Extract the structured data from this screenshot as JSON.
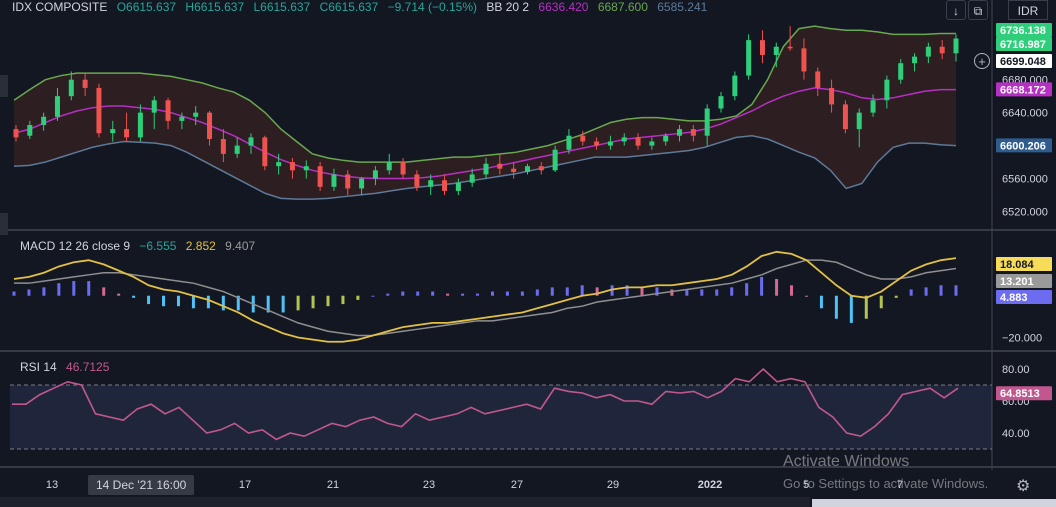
{
  "header": {
    "symbol": "IDX COMPOSITE",
    "o": "O6615.637",
    "h": "H6615.637",
    "l": "L6615.637",
    "c": "C6615.637",
    "chg": "−9.714 (−0.15%)",
    "bb_label": "BB 20 2",
    "bb_mid": "6636.420",
    "bb_up": "6687.600",
    "bb_low": "6585.241",
    "currency": "IDR"
  },
  "macd_legend": {
    "label": "MACD 12 26 close 9",
    "hist": "−6.555",
    "macd": "2.852",
    "signal": "9.407"
  },
  "rsi_legend": {
    "label": "RSI 14",
    "value": "46.7125"
  },
  "xtooltip": "14 Dec '21  16:00",
  "watermark": {
    "title": "Activate Windows",
    "sub": "Go to Settings to activate Windows."
  },
  "colors": {
    "bg": "#131722",
    "up": "#26a69a",
    "upFill": "#2fce7a",
    "down": "#ef5350",
    "bbUpper": "#6aa84f",
    "bbBasis": "#b82fc5",
    "bbLower": "#5d7a99",
    "bbFill": "rgba(120,50,30,0.25)",
    "macd": "#e2c043",
    "signal": "#8f8f8f",
    "histPos": "#6c6cf0",
    "histNeg": "#4fc3f7",
    "rsi": "#c2578f",
    "rsiBand": "rgba(90,110,180,0.18)"
  },
  "chart_data": [
    {
      "type": "candlestick",
      "title": "IDX COMPOSITE",
      "ylim": [
        6500,
        6750
      ],
      "yticks": [
        6520,
        6560,
        6600,
        6640,
        6680
      ],
      "price_labels": [
        {
          "value": 6736.138,
          "text": "6736.138",
          "color": "#2fce7a"
        },
        {
          "value": 6716.987,
          "text": "6716.987",
          "color": "#2fce7a"
        },
        {
          "value": 6699.048,
          "text": "6699.048",
          "color": "#131722"
        },
        {
          "value": 6668.172,
          "text": "6668.172",
          "color": "#b82fc5"
        },
        {
          "value": 6600.206,
          "text": "6600.206",
          "color": "#2f5c8f"
        }
      ],
      "candles": [
        [
          6620,
          6625,
          6605,
          6610
        ],
        [
          6612,
          6630,
          6608,
          6625
        ],
        [
          6625,
          6640,
          6618,
          6635
        ],
        [
          6635,
          6670,
          6630,
          6660
        ],
        [
          6660,
          6690,
          6655,
          6680
        ],
        [
          6680,
          6688,
          6660,
          6670
        ],
        [
          6670,
          6675,
          6610,
          6615
        ],
        [
          6615,
          6630,
          6605,
          6620
        ],
        [
          6620,
          6640,
          6605,
          6610
        ],
        [
          6610,
          6650,
          6605,
          6640
        ],
        [
          6640,
          6660,
          6620,
          6655
        ],
        [
          6655,
          6658,
          6620,
          6630
        ],
        [
          6630,
          6640,
          6620,
          6635
        ],
        [
          6635,
          6648,
          6625,
          6640
        ],
        [
          6640,
          6642,
          6600,
          6608
        ],
        [
          6608,
          6620,
          6580,
          6590
        ],
        [
          6590,
          6610,
          6585,
          6600
        ],
        [
          6600,
          6615,
          6590,
          6610
        ],
        [
          6610,
          6612,
          6570,
          6575
        ],
        [
          6575,
          6590,
          6565,
          6580
        ],
        [
          6580,
          6585,
          6560,
          6570
        ],
        [
          6570,
          6582,
          6560,
          6575
        ],
        [
          6575,
          6580,
          6545,
          6550
        ],
        [
          6550,
          6572,
          6545,
          6565
        ],
        [
          6565,
          6570,
          6540,
          6548
        ],
        [
          6548,
          6562,
          6540,
          6560
        ],
        [
          6560,
          6575,
          6552,
          6570
        ],
        [
          6570,
          6590,
          6565,
          6580
        ],
        [
          6580,
          6585,
          6560,
          6565
        ],
        [
          6565,
          6570,
          6545,
          6550
        ],
        [
          6550,
          6565,
          6540,
          6558
        ],
        [
          6558,
          6565,
          6540,
          6545
        ],
        [
          6545,
          6560,
          6540,
          6555
        ],
        [
          6555,
          6572,
          6550,
          6565
        ],
        [
          6565,
          6585,
          6560,
          6578
        ],
        [
          6578,
          6590,
          6565,
          6572
        ],
        [
          6572,
          6580,
          6560,
          6568
        ],
        [
          6568,
          6578,
          6565,
          6575
        ],
        [
          6575,
          6580,
          6565,
          6570
        ],
        [
          6570,
          6600,
          6568,
          6595
        ],
        [
          6595,
          6620,
          6590,
          6612
        ],
        [
          6612,
          6618,
          6600,
          6605
        ],
        [
          6605,
          6610,
          6595,
          6600
        ],
        [
          6600,
          6612,
          6595,
          6605
        ],
        [
          6605,
          6615,
          6600,
          6610
        ],
        [
          6610,
          6615,
          6595,
          6600
        ],
        [
          6600,
          6610,
          6595,
          6605
        ],
        [
          6605,
          6615,
          6600,
          6612
        ],
        [
          6612,
          6625,
          6605,
          6620
        ],
        [
          6620,
          6625,
          6605,
          6612
        ],
        [
          6612,
          6650,
          6600,
          6645
        ],
        [
          6645,
          6665,
          6640,
          6660
        ],
        [
          6660,
          6690,
          6655,
          6685
        ],
        [
          6685,
          6735,
          6680,
          6728
        ],
        [
          6728,
          6740,
          6700,
          6710
        ],
        [
          6710,
          6725,
          6695,
          6720
        ],
        [
          6720,
          6745,
          6715,
          6718
        ],
        [
          6718,
          6730,
          6680,
          6690
        ],
        [
          6690,
          6695,
          6660,
          6670
        ],
        [
          6670,
          6680,
          6640,
          6650
        ],
        [
          6650,
          6655,
          6615,
          6620
        ],
        [
          6620,
          6645,
          6598,
          6640
        ],
        [
          6640,
          6662,
          6635,
          6655
        ],
        [
          6655,
          6685,
          6645,
          6680
        ],
        [
          6680,
          6705,
          6675,
          6700
        ],
        [
          6700,
          6712,
          6690,
          6708
        ],
        [
          6708,
          6725,
          6700,
          6720
        ],
        [
          6720,
          6728,
          6705,
          6712
        ],
        [
          6712,
          6735,
          6702,
          6730
        ]
      ],
      "bb_upper": [
        6655,
        6668,
        6680,
        6685,
        6688,
        6688,
        6688,
        6688,
        6688,
        6686,
        6684,
        6680,
        6676,
        6670,
        6665,
        6655,
        6640,
        6620,
        6605,
        6590,
        6585,
        6582,
        6580,
        6580,
        6580,
        6580,
        6582,
        6584,
        6586,
        6586,
        6588,
        6590,
        6592,
        6596,
        6600,
        6606,
        6612,
        6620,
        6628,
        6632,
        6634,
        6634,
        6632,
        6630,
        6630,
        6632,
        6636,
        6650,
        6680,
        6720,
        6742,
        6745,
        6742,
        6740,
        6740,
        6738,
        6735,
        6735,
        6735,
        6736,
        6736
      ],
      "bb_basis": [
        6615,
        6620,
        6628,
        6636,
        6642,
        6646,
        6648,
        6648,
        6646,
        6644,
        6640,
        6634,
        6628,
        6620,
        6612,
        6602,
        6592,
        6583,
        6576,
        6570,
        6566,
        6563,
        6561,
        6560,
        6560,
        6560,
        6561,
        6563,
        6566,
        6569,
        6572,
        6576,
        6580,
        6584,
        6588,
        6592,
        6596,
        6600,
        6604,
        6608,
        6610,
        6612,
        6614,
        6616,
        6620,
        6626,
        6634,
        6642,
        6652,
        6660,
        6666,
        6670,
        6668,
        6664,
        6658,
        6656,
        6658,
        6662,
        6666,
        6668,
        6668
      ],
      "bb_lower": [
        6575,
        6576,
        6580,
        6586,
        6592,
        6598,
        6602,
        6605,
        6604,
        6603,
        6600,
        6592,
        6582,
        6572,
        6562,
        6552,
        6542,
        6536,
        6535,
        6535,
        6536,
        6538,
        6540,
        6542,
        6545,
        6548,
        6550,
        6552,
        6554,
        6557,
        6560,
        6563,
        6566,
        6570,
        6574,
        6578,
        6582,
        6586,
        6586,
        6586,
        6588,
        6590,
        6592,
        6594,
        6598,
        6604,
        6610,
        6612,
        6608,
        6600,
        6592,
        6585,
        6570,
        6548,
        6554,
        6580,
        6598,
        6603,
        6603,
        6601,
        6600
      ]
    },
    {
      "type": "line",
      "title": "MACD 12 26 close 9",
      "ylim": [
        -25,
        30
      ],
      "yticks": [
        -20,
        0
      ],
      "ytick_labels": [
        "−20.000",
        "0.000"
      ],
      "price_labels": [
        {
          "value": 18.084,
          "text": "18.084",
          "color": "#f7dc5a"
        },
        {
          "value": 13.201,
          "text": "13.201",
          "color": "#9a9a9a"
        },
        {
          "value": 4.883,
          "text": "4.883",
          "color": "#6c6cf0"
        }
      ],
      "series": [
        {
          "name": "MACD",
          "values": [
            8,
            9,
            11,
            14,
            16,
            17,
            15,
            12,
            9,
            5,
            3,
            2,
            0,
            -2,
            -5,
            -8,
            -12,
            -15,
            -18,
            -20,
            -21,
            -22,
            -22,
            -21,
            -19,
            -17,
            -15,
            -14,
            -13,
            -13,
            -12,
            -11,
            -10,
            -9,
            -8,
            -6,
            -4,
            -2,
            0,
            1,
            3,
            4,
            4,
            5,
            5,
            6,
            7,
            8,
            10,
            14,
            19,
            21,
            20,
            17,
            11,
            5,
            0,
            -1,
            2,
            7,
            12,
            15,
            17,
            18
          ]
        },
        {
          "name": "Signal",
          "values": [
            6,
            6,
            7,
            8,
            9,
            10,
            11,
            11,
            10,
            9,
            8,
            7,
            6,
            4,
            2,
            -1,
            -4,
            -7,
            -10,
            -13,
            -15,
            -17,
            -18,
            -19,
            -19,
            -18,
            -17,
            -16,
            -15,
            -14,
            -13,
            -12,
            -12,
            -11,
            -10,
            -9,
            -8,
            -6,
            -5,
            -3,
            -2,
            -1,
            0,
            1,
            2,
            3,
            4,
            5,
            6,
            8,
            10,
            13,
            15,
            17,
            17,
            16,
            13,
            10,
            8,
            8,
            9,
            11,
            12,
            13
          ]
        },
        {
          "name": "Histogram",
          "values": [
            2,
            3,
            4,
            6,
            7,
            7,
            4,
            1,
            -1,
            -4,
            -5,
            -5,
            -6,
            -6,
            -7,
            -7,
            -8,
            -8,
            -8,
            -7,
            -6,
            -5,
            -4,
            -2,
            0,
            1,
            2,
            2,
            2,
            1,
            1,
            1,
            2,
            2,
            2,
            3,
            4,
            4,
            5,
            4,
            5,
            5,
            4,
            4,
            3,
            3,
            3,
            3,
            4,
            6,
            9,
            8,
            5,
            0,
            -6,
            -11,
            -13,
            -11,
            -6,
            -1,
            3,
            4,
            5,
            5
          ]
        }
      ]
    },
    {
      "type": "line",
      "title": "RSI 14",
      "ylim": [
        20,
        90
      ],
      "yticks": [
        40,
        60,
        80
      ],
      "ytick_labels": [
        "40.00",
        "60.00",
        "80.00"
      ],
      "bands": [
        30,
        70
      ],
      "price_labels": [
        {
          "value": 64.8513,
          "text": "64.8513",
          "color": "#c2578f"
        }
      ],
      "series": [
        {
          "name": "RSI",
          "values": [
            58,
            58,
            64,
            68,
            72,
            70,
            52,
            50,
            48,
            55,
            58,
            52,
            56,
            48,
            40,
            42,
            46,
            40,
            42,
            36,
            40,
            38,
            42,
            46,
            44,
            48,
            50,
            46,
            44,
            52,
            48,
            50,
            52,
            56,
            52,
            54,
            56,
            58,
            55,
            68,
            66,
            65,
            62,
            64,
            60,
            60,
            58,
            66,
            65,
            66,
            62,
            66,
            74,
            72,
            80,
            72,
            74,
            72,
            56,
            50,
            40,
            38,
            44,
            52,
            64,
            66,
            68,
            62,
            68
          ]
        }
      ]
    },
    {
      "type": "axis",
      "x_tick_labels": [
        "13",
        "17",
        "21",
        "23",
        "27",
        "29",
        "2022",
        "5",
        "7"
      ]
    }
  ]
}
